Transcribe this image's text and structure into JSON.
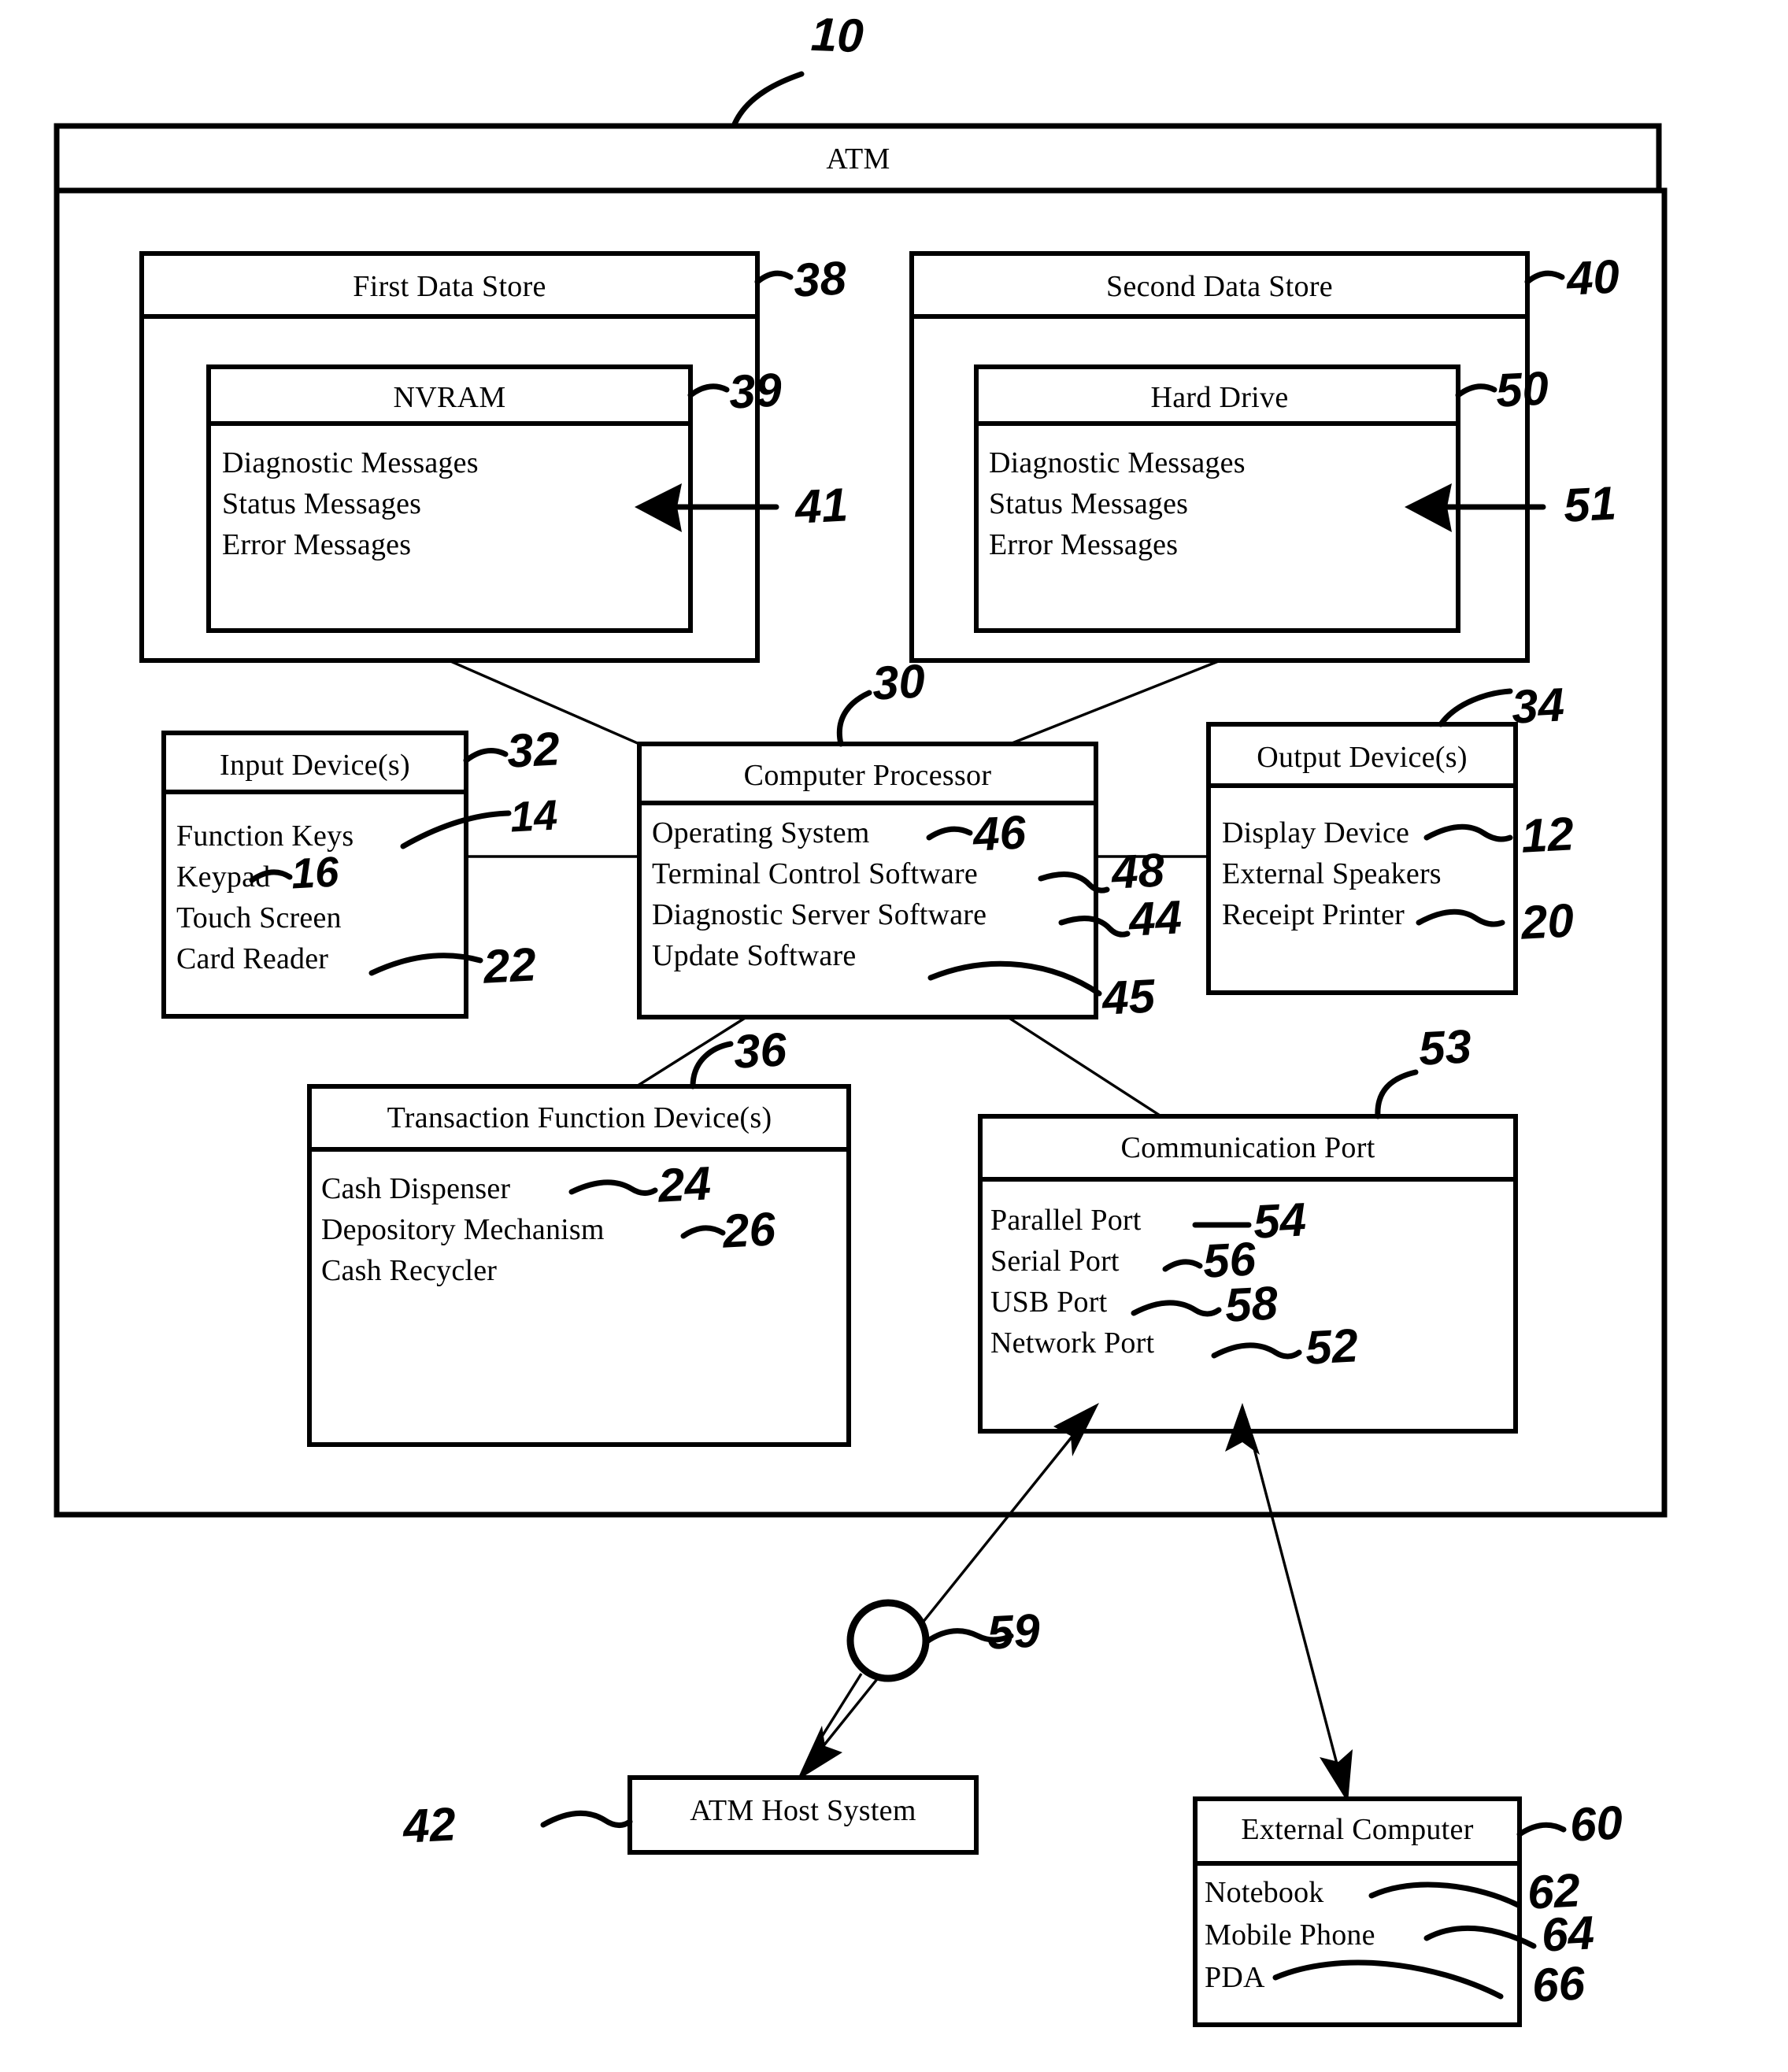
{
  "figure": {
    "ref_root": "10",
    "atm_title": "ATM"
  },
  "first_data_store": {
    "title": "First Data Store",
    "ref": "38",
    "inner": {
      "title": "NVRAM",
      "ref": "39",
      "items_ref": "41",
      "items": [
        "Diagnostic Messages",
        "Status Messages",
        "Error Messages"
      ]
    }
  },
  "second_data_store": {
    "title": "Second Data Store",
    "ref": "40",
    "inner": {
      "title": "Hard Drive",
      "ref": "50",
      "items_ref": "51",
      "items": [
        "Diagnostic Messages",
        "Status Messages",
        "Error Messages"
      ]
    }
  },
  "input_devices": {
    "title": "Input Device(s)",
    "ref": "32",
    "items": [
      {
        "label": "Function Keys",
        "ref": "14"
      },
      {
        "label": "Keypad",
        "ref": "16"
      },
      {
        "label": "Touch Screen",
        "ref": ""
      },
      {
        "label": "Card Reader",
        "ref": "22"
      }
    ]
  },
  "computer_processor": {
    "title": "Computer Processor",
    "ref": "30",
    "items": [
      {
        "label": "Operating System",
        "ref": "46"
      },
      {
        "label": "Terminal Control Software",
        "ref": "48"
      },
      {
        "label": "Diagnostic Server Software",
        "ref": "44"
      },
      {
        "label": "Update Software",
        "ref": "45"
      }
    ]
  },
  "output_devices": {
    "title": "Output Device(s)",
    "ref": "34",
    "items": [
      {
        "label": "Display Device",
        "ref": "12"
      },
      {
        "label": "External Speakers",
        "ref": ""
      },
      {
        "label": "Receipt Printer",
        "ref": "20"
      }
    ]
  },
  "transaction_function_devices": {
    "title": "Transaction Function Device(s)",
    "ref": "36",
    "items": [
      {
        "label": "Cash Dispenser",
        "ref": "24"
      },
      {
        "label": "Depository Mechanism",
        "ref": "26"
      },
      {
        "label": "Cash Recycler",
        "ref": ""
      }
    ]
  },
  "communication_port": {
    "title": "Communication Port",
    "ref": "53",
    "items": [
      {
        "label": "Parallel Port",
        "ref": "54"
      },
      {
        "label": "Serial Port",
        "ref": "56"
      },
      {
        "label": "USB Port",
        "ref": "58"
      },
      {
        "label": "Network Port",
        "ref": "52"
      }
    ]
  },
  "network_node": {
    "ref": "59"
  },
  "atm_host_system": {
    "title": "ATM Host System",
    "ref": "42"
  },
  "external_computer": {
    "title": "External Computer",
    "ref": "60",
    "items": [
      {
        "label": "Notebook",
        "ref": "62"
      },
      {
        "label": "Mobile Phone",
        "ref": "64"
      },
      {
        "label": "PDA",
        "ref": "66"
      }
    ]
  }
}
